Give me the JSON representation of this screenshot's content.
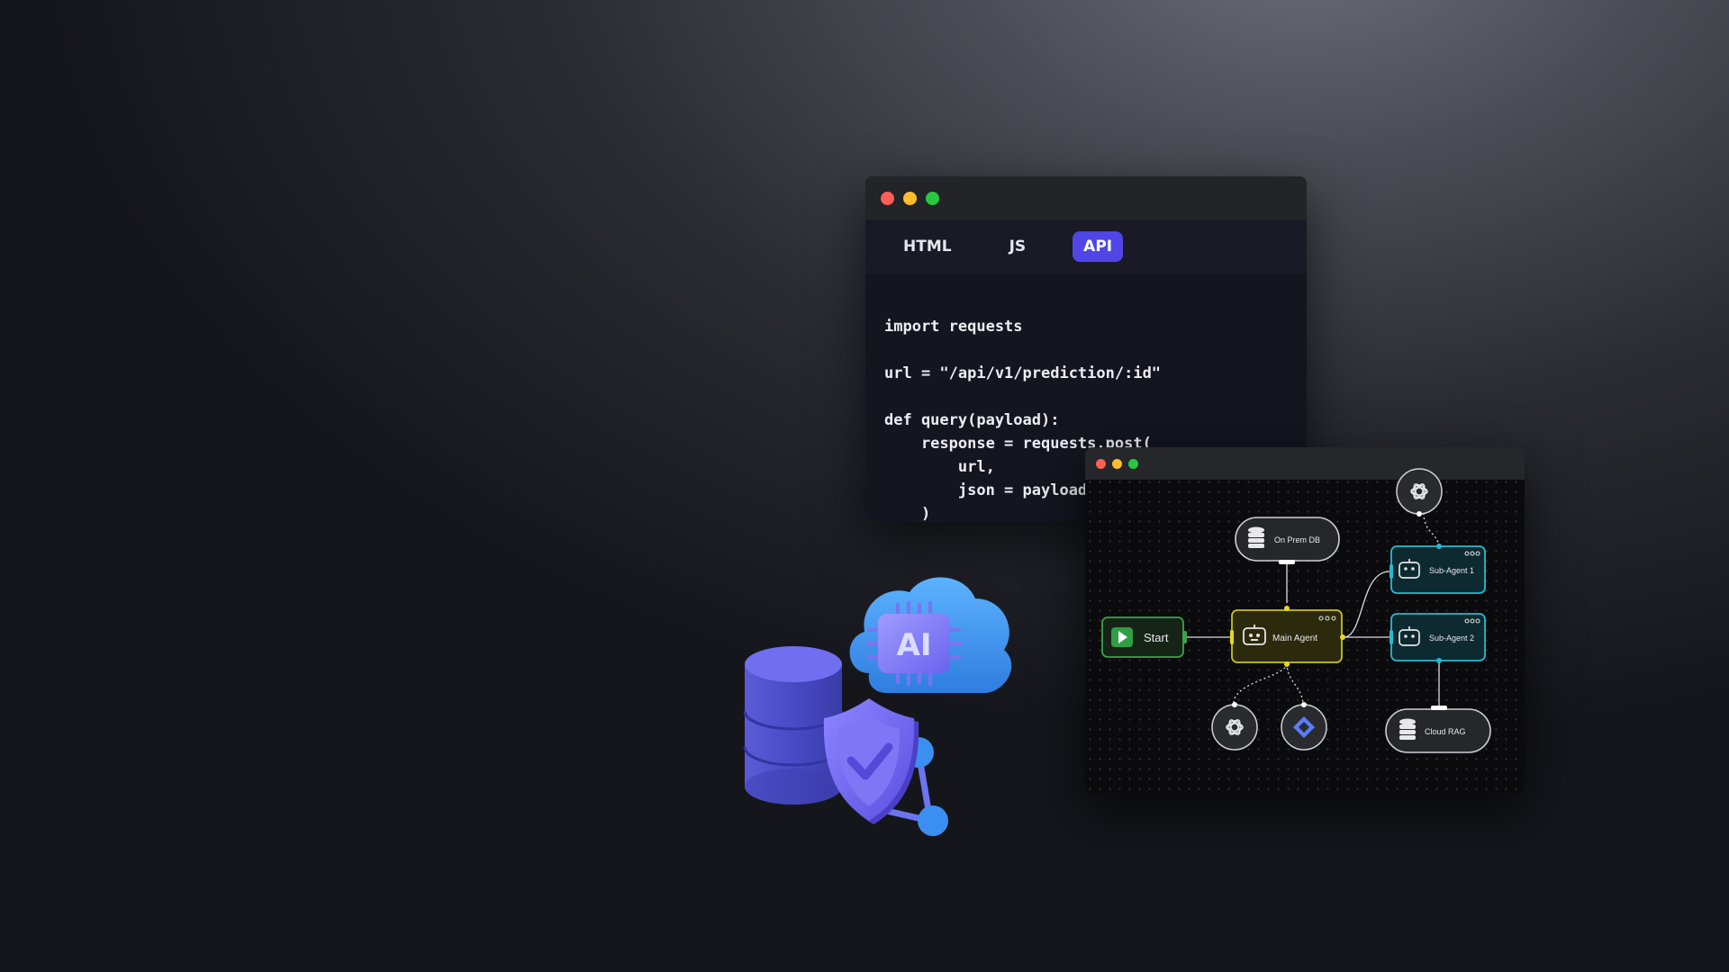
{
  "code_window": {
    "tabs": [
      {
        "label": "HTML",
        "active": false
      },
      {
        "label": "JS",
        "active": false
      },
      {
        "label": "API",
        "active": true
      }
    ],
    "code": "import requests\n\nurl = \"/api/v1/prediction/:id\"\n\ndef query(payload):\n    response = requests.post(\n        url,\n        json = payload\n    )",
    "colors": {
      "active_tab": "#4f46e5",
      "close": "#ff5f57",
      "minimize": "#febc2e",
      "maximize": "#28c840"
    }
  },
  "flow_window": {
    "nodes": {
      "start": "Start",
      "main_agent": "Main Agent",
      "sub_agent_1": "Sub-Agent 1",
      "sub_agent_2": "Sub-Agent 2",
      "on_prem_db": "On Prem DB",
      "cloud_rag": "Cloud RAG"
    },
    "icons": [
      "play-icon",
      "robot-icon",
      "database-icon",
      "openai-icon",
      "diamond-icon",
      "more-dots-icon"
    ],
    "colors": {
      "start": "#3ba34a",
      "main_agent": "#c9c21e",
      "sub_agent": "#28b9d1",
      "edge_dot": "#e8d91f"
    }
  },
  "illustration": {
    "cloud_label": "AI",
    "icons": [
      "database-stack-icon",
      "ai-chip-icon",
      "cloud-icon",
      "shield-check-icon",
      "network-icon"
    ]
  }
}
